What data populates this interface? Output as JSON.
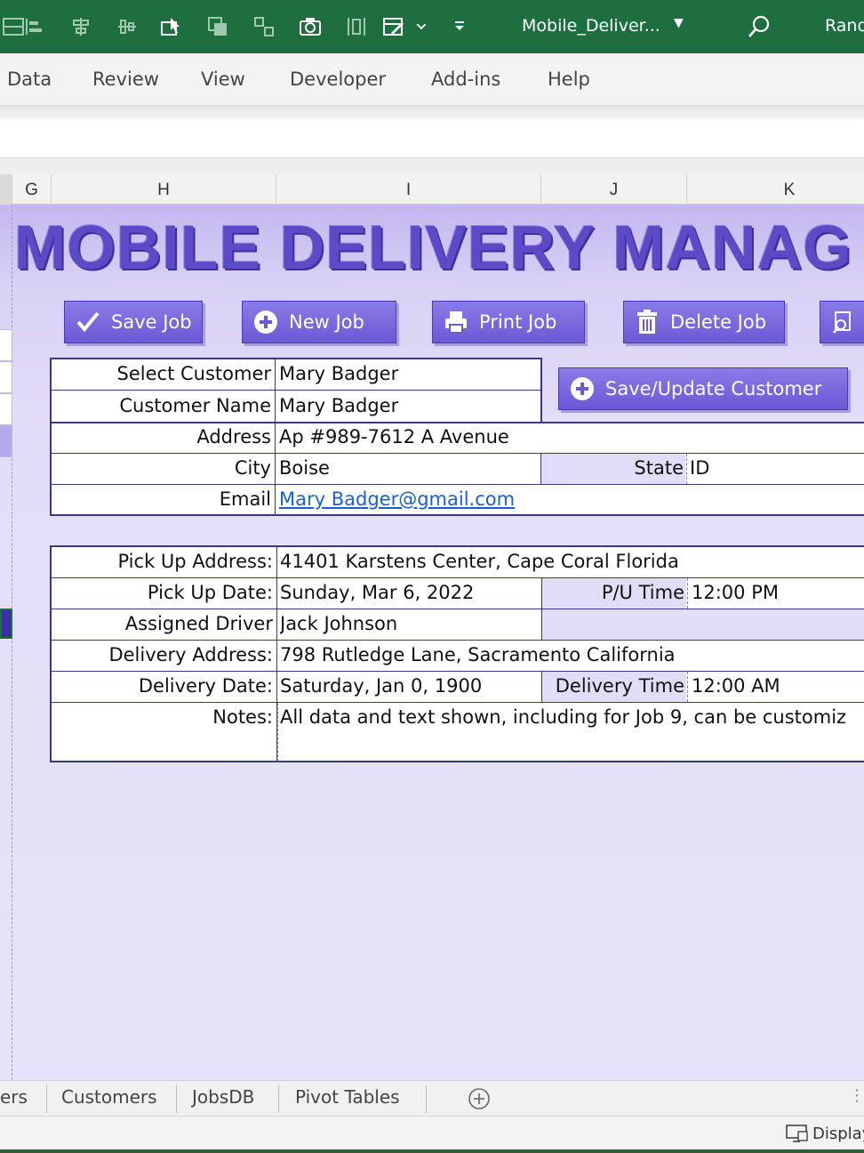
{
  "app": {
    "doc_title": "Mobile_Deliver...",
    "user_name": "Rand",
    "brand_color": "#1f6e3f"
  },
  "ribbon": {
    "tabs": [
      "Data",
      "Review",
      "View",
      "Developer",
      "Add-ins",
      "Help"
    ]
  },
  "columns": [
    "G",
    "H",
    "I",
    "J",
    "K"
  ],
  "sheet": {
    "title": "MOBILE DELIVERY MANAG",
    "accent_color": "#6b59d6",
    "buttons": {
      "save_job": "Save Job",
      "new_job": "New Job",
      "print_job": "Print Job",
      "delete_job": "Delete Job",
      "save_update_customer": "Save/Update Customer"
    },
    "customer": {
      "select_customer_label": "Select Customer",
      "select_customer_value": "Mary Badger",
      "customer_name_label": "Customer Name",
      "customer_name_value": "Mary Badger",
      "address_label": "Address",
      "address_value": "Ap #989-7612 A Avenue",
      "city_label": "City",
      "city_value": "Boise",
      "state_label": "State",
      "state_value": "ID",
      "email_label": "Email",
      "email_value": "Mary Badger@gmail.com"
    },
    "job": {
      "pickup_address_label": "Pick Up Address:",
      "pickup_address_value": "41401 Karstens Center, Cape Coral Florida",
      "pickup_date_label": "Pick Up Date:",
      "pickup_date_value": "Sunday, Mar 6, 2022",
      "pu_time_label": "P/U Time",
      "pu_time_value": "12:00 PM",
      "driver_label": "Assigned Driver",
      "driver_value": "Jack Johnson",
      "delivery_address_label": "Delivery Address:",
      "delivery_address_value": "798 Rutledge Lane, Sacramento California",
      "delivery_date_label": "Delivery Date:",
      "delivery_date_value": "Saturday, Jan 0, 1900",
      "delivery_time_label": "Delivery Time",
      "delivery_time_value": "12:00 AM",
      "notes_label": "Notes:",
      "notes_value": "All data and text shown, including for Job 9, can be customiz"
    }
  },
  "sheet_tabs": [
    "ers",
    "Customers",
    "JobsDB",
    "Pivot Tables"
  ],
  "status": {
    "display_label": "Display"
  }
}
